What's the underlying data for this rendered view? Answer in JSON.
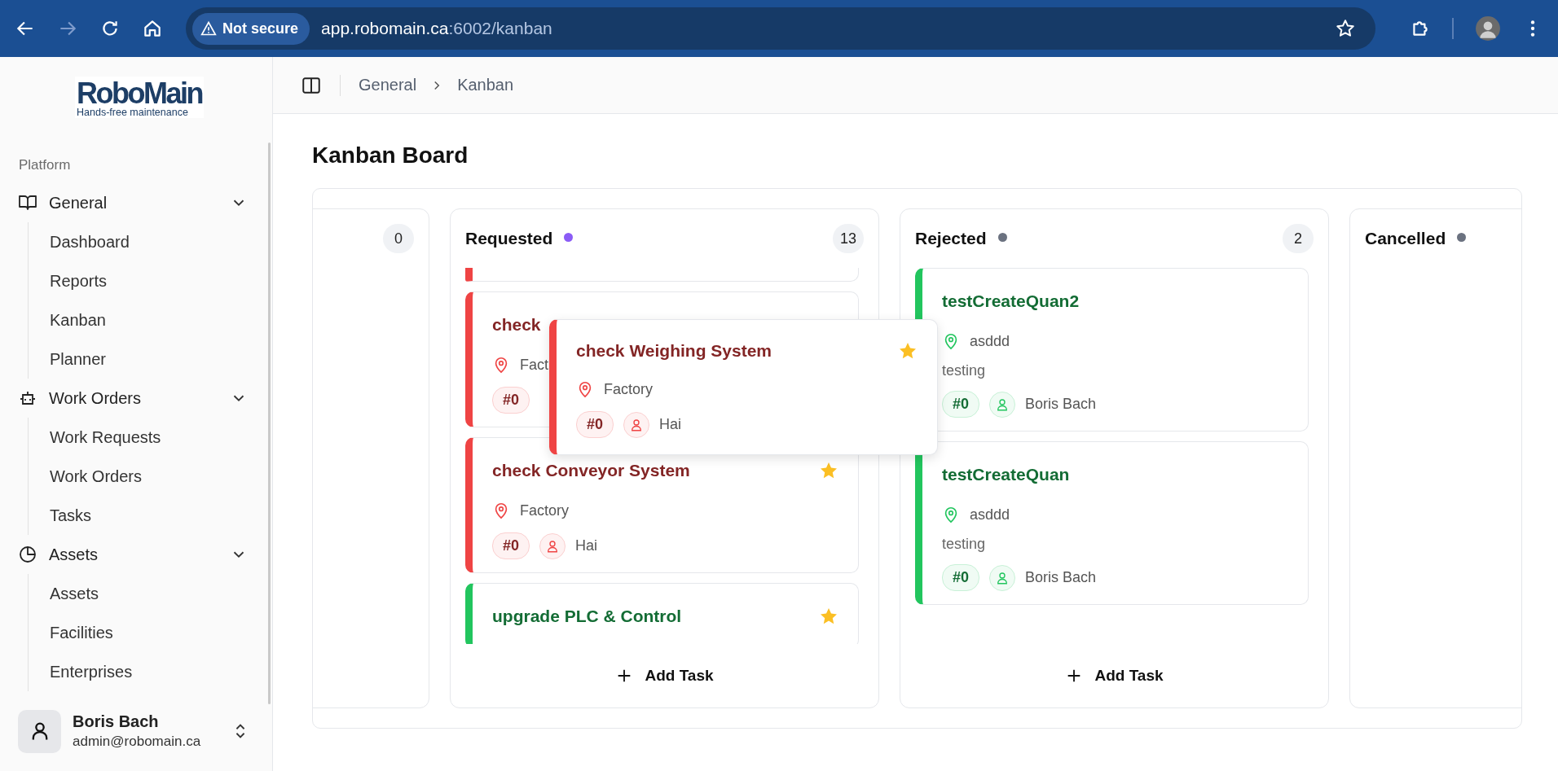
{
  "browser": {
    "forward_disabled": true,
    "security_label": "Not secure",
    "url_host": "app.robomain.ca",
    "url_path": ":6002/kanban"
  },
  "sidebar": {
    "logo": {
      "name": "RoboMain",
      "tagline": "Hands-free maintenance"
    },
    "section": "Platform",
    "groups": [
      {
        "label": "General",
        "expanded": true,
        "children": [
          {
            "label": "Dashboard"
          },
          {
            "label": "Reports"
          },
          {
            "label": "Kanban"
          },
          {
            "label": "Planner"
          }
        ]
      },
      {
        "label": "Work Orders",
        "expanded": true,
        "children": [
          {
            "label": "Work Requests"
          },
          {
            "label": "Work Orders"
          },
          {
            "label": "Tasks"
          }
        ]
      },
      {
        "label": "Assets",
        "expanded": true,
        "children": [
          {
            "label": "Assets"
          },
          {
            "label": "Facilities"
          },
          {
            "label": "Enterprises"
          }
        ]
      }
    ],
    "user": {
      "name": "Boris Bach",
      "email": "admin@robomain.ca"
    }
  },
  "breadcrumb": [
    "General",
    "Kanban"
  ],
  "page_title": "Kanban Board",
  "columns": [
    {
      "count": "0"
    },
    {
      "title": "Requested",
      "color": "#8b5cf6",
      "count": "13",
      "add_task": "Add Task",
      "cards": [
        {
          "kind": "stub",
          "color": "#ef4444"
        },
        {
          "kind": "card",
          "title": "check",
          "color": "#ef4444",
          "location": "Fact",
          "tag": "#0",
          "starred": false
        },
        {
          "kind": "card",
          "title": "check Conveyor System",
          "color": "#ef4444",
          "location": "Factory",
          "tag": "#0",
          "assignee": "Hai",
          "starred": true
        },
        {
          "kind": "card",
          "title": "upgrade PLC & Control",
          "color": "#22c55e",
          "starred": true
        }
      ],
      "dragged_card": {
        "title": "check Weighing System",
        "color": "#ef4444",
        "location": "Factory",
        "tag": "#0",
        "assignee": "Hai",
        "starred": true
      }
    },
    {
      "title": "Rejected",
      "color": "#6b7280",
      "count": "2",
      "add_task": "Add Task",
      "cards": [
        {
          "kind": "card",
          "title": "testCreateQuan2",
          "color": "#22c55e",
          "location": "asddd",
          "description": "testing",
          "tag": "#0",
          "assignee": "Boris Bach",
          "starred": false
        },
        {
          "kind": "card",
          "title": "testCreateQuan",
          "color": "#22c55e",
          "location": "asddd",
          "description": "testing",
          "tag": "#0",
          "assignee": "Boris Bach",
          "starred": false
        }
      ]
    },
    {
      "title": "Cancelled",
      "color": "#6b7280"
    }
  ]
}
